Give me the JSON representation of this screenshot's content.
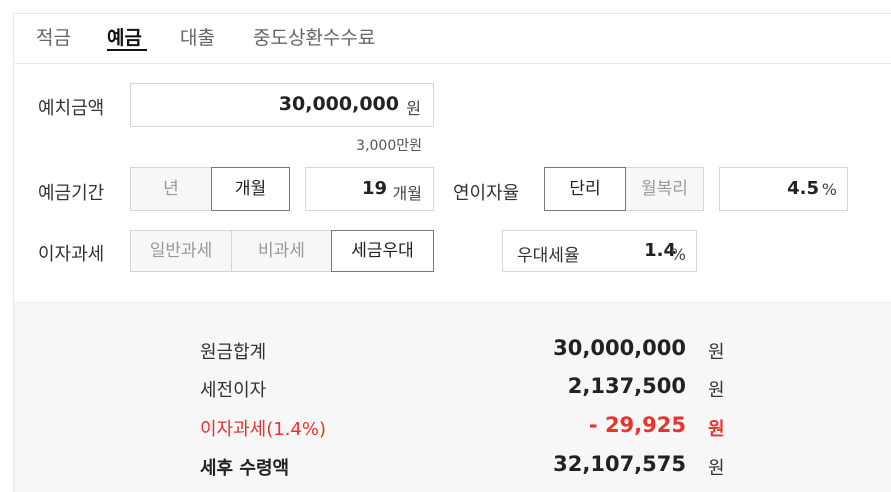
{
  "tabs": [
    {
      "label": "적금"
    },
    {
      "label": "예금"
    },
    {
      "label": "대출"
    },
    {
      "label": "중도상환수수료"
    }
  ],
  "deposit_amount": {
    "label": "예치금액",
    "value": "30,000,000",
    "unit": "원",
    "hint": "3,000만원"
  },
  "deposit_period": {
    "label": "예금기간",
    "options": [
      "년",
      "개월"
    ],
    "selected": "개월",
    "value": "19",
    "unit": "개월"
  },
  "annual_rate": {
    "label": "연이자율",
    "options": [
      "단리",
      "월복리"
    ],
    "selected": "단리",
    "value": "4.5",
    "unit": "%"
  },
  "interest_tax": {
    "label": "이자과세",
    "options": [
      "일반과세",
      "비과세",
      "세금우대"
    ],
    "selected": "세금우대",
    "preferential_label": "우대세율",
    "preferential_value": "1.4",
    "preferential_unit": "%"
  },
  "result": {
    "principal_label": "원금합계",
    "principal_value": "30,000,000",
    "pretax_label": "세전이자",
    "pretax_value": "2,137,500",
    "tax_label": "이자과세(1.4%)",
    "tax_value": "- 29,925",
    "net_label": "세후 수령액",
    "net_value": "32,107,575",
    "unit": "원"
  },
  "colors": {
    "accent_red": "#e8332f",
    "selected_border": "#777777",
    "unselected_bg": "#f6f7f9",
    "result_bg": "#f7f7f7"
  }
}
